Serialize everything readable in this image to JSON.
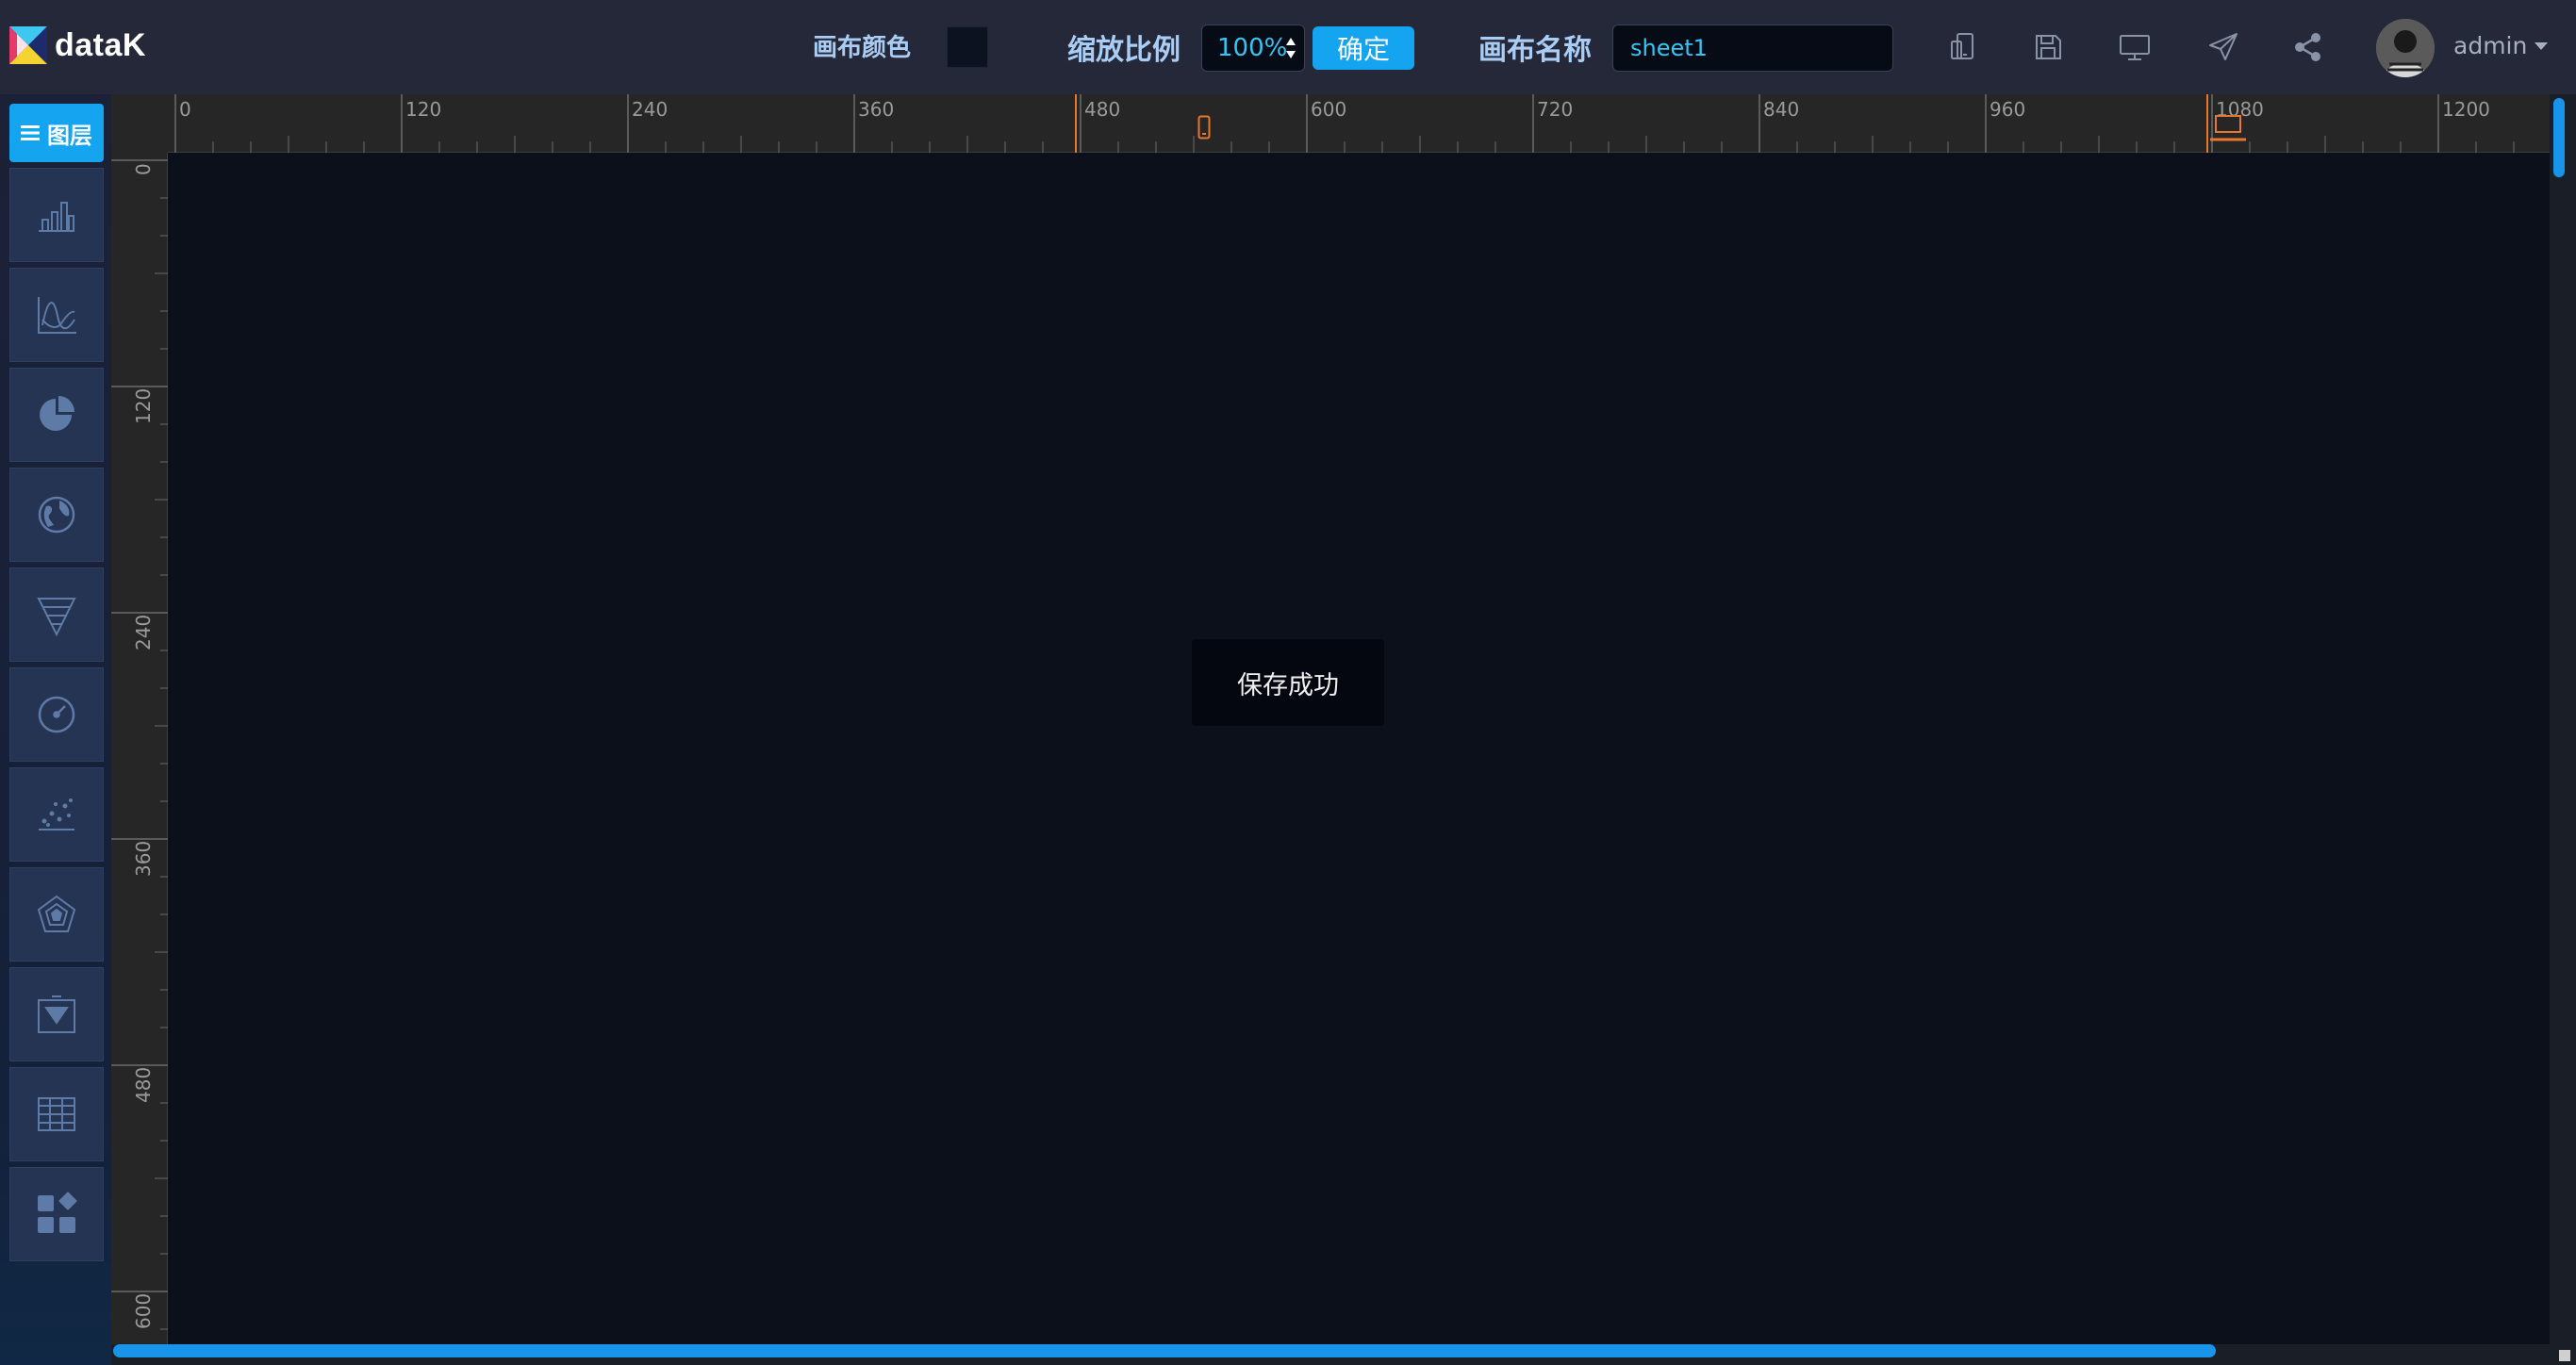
{
  "app": {
    "name": "dataK"
  },
  "header": {
    "canvas_color_label": "画布颜色",
    "canvas_color_value": "#0c1220",
    "zoom_label": "缩放比例",
    "zoom_value": "100%",
    "confirm_label": "确定",
    "canvas_name_label": "画布名称",
    "canvas_name_value": "sheet1",
    "tools": [
      "device-switch-icon",
      "save-icon",
      "preview-icon",
      "publish-icon",
      "share-icon"
    ],
    "username": "admin"
  },
  "sidebar": {
    "layer_button": "图层",
    "tools": [
      "bar-chart-icon",
      "line-chart-icon",
      "pie-chart-icon",
      "globe-map-icon",
      "funnel-icon",
      "gauge-icon",
      "scatter-icon",
      "radar-icon",
      "filter-widget-icon",
      "table-icon",
      "widgets-icon"
    ]
  },
  "rulers": {
    "horizontal_labels": [
      "0",
      "120",
      "240",
      "360",
      "480",
      "600",
      "720",
      "840",
      "960",
      "1080",
      "1200"
    ],
    "vertical_labels": [
      "0",
      "120",
      "240",
      "360",
      "480",
      "600"
    ],
    "markers": [
      "phone-marker-icon",
      "laptop-marker-icon"
    ]
  },
  "toast": {
    "message": "保存成功"
  },
  "colors": {
    "accent": "#15a4ef",
    "header_bg": "#252838",
    "canvas_bg": "#0b101b",
    "marker": "#e8772e"
  }
}
